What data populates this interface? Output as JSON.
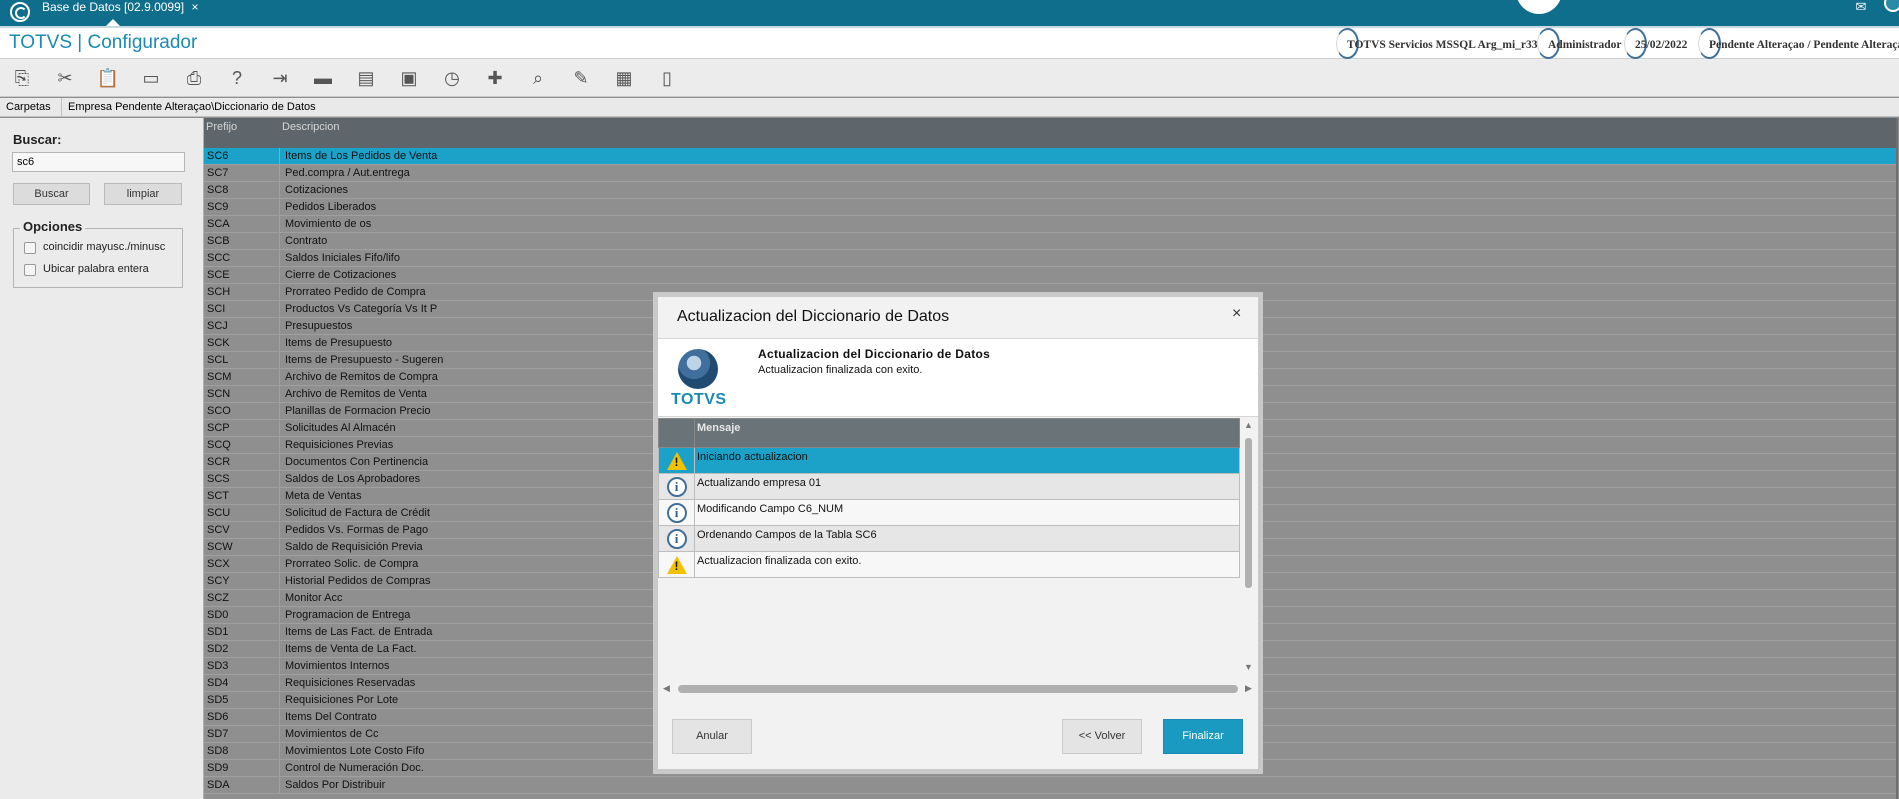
{
  "titlebar": {
    "tab_label": "Base de Datos [02.9.0099]",
    "tab_close": "×",
    "mail_icon": "✉"
  },
  "header": {
    "brand": "TOTVS | Configurador",
    "server": "TOTVS Servicios MSSQL Arg_mi_r33",
    "user": "Administrador",
    "date": "25/02/2022",
    "status": "Pendente Alteraçao / Pendente Alteraça"
  },
  "toolbar": {
    "icons": [
      "copy-icon",
      "cut-icon",
      "paste-icon",
      "eraser-icon",
      "print-icon",
      "help-icon",
      "exit-icon",
      "folder-icon",
      "table-icon",
      "save-icon",
      "disk-clock-icon",
      "add-icon",
      "search-icon",
      "edit-icon",
      "grid-icon",
      "document-icon"
    ],
    "glyphs": [
      "⎘",
      "✂",
      "📋",
      "▭",
      "⎙",
      "?",
      "⇥",
      "▬",
      "▤",
      "▣",
      "◷",
      "✚",
      "⌕",
      "✎",
      "▦",
      "▯"
    ]
  },
  "pathbar": {
    "folders_label": "Carpetas",
    "path": "Empresa Pendente Alteraçao\\Diccionario de Datos"
  },
  "leftpanel": {
    "search_label": "Buscar:",
    "search_value": "sc6",
    "buscar_button": "Buscar",
    "limpiar_button": "limpiar",
    "options_label": "Opciones",
    "option1": "coincidir mayusc./minusc",
    "option2": "Ubicar palabra entera"
  },
  "grid": {
    "col_prefix": "Prefijo",
    "col_desc": "Descripcion",
    "rows": [
      {
        "p": "SC6",
        "d": "Items de Los Pedidos de Venta"
      },
      {
        "p": "SC7",
        "d": "Ped.compra / Aut.entrega"
      },
      {
        "p": "SC8",
        "d": "Cotizaciones"
      },
      {
        "p": "SC9",
        "d": "Pedidos Liberados"
      },
      {
        "p": "SCA",
        "d": "Movimiento de os"
      },
      {
        "p": "SCB",
        "d": "Contrato"
      },
      {
        "p": "SCC",
        "d": "Saldos Iniciales Fifo/lifo"
      },
      {
        "p": "SCE",
        "d": "Cierre de Cotizaciones"
      },
      {
        "p": "SCH",
        "d": "Prorrateo Pedido de Compra"
      },
      {
        "p": "SCI",
        "d": "Productos Vs Categoría Vs It P"
      },
      {
        "p": "SCJ",
        "d": "Presupuestos"
      },
      {
        "p": "SCK",
        "d": "Items de Presupuesto"
      },
      {
        "p": "SCL",
        "d": "Items de Presupuesto - Sugeren"
      },
      {
        "p": "SCM",
        "d": "Archivo de Remitos de Compra"
      },
      {
        "p": "SCN",
        "d": "Archivo de Remitos de Venta"
      },
      {
        "p": "SCO",
        "d": "Planillas de Formacion Precio"
      },
      {
        "p": "SCP",
        "d": "Solicitudes Al Almacén"
      },
      {
        "p": "SCQ",
        "d": "Requisiciones Previas"
      },
      {
        "p": "SCR",
        "d": "Documentos Con Pertinencia"
      },
      {
        "p": "SCS",
        "d": "Saldos de Los Aprobadores"
      },
      {
        "p": "SCT",
        "d": "Meta de Ventas"
      },
      {
        "p": "SCU",
        "d": "Solicitud de Factura de Crédit"
      },
      {
        "p": "SCV",
        "d": "Pedidos Vs. Formas de Pago"
      },
      {
        "p": "SCW",
        "d": "Saldo de Requisición Previa"
      },
      {
        "p": "SCX",
        "d": "Prorrateo Solic. de Compra"
      },
      {
        "p": "SCY",
        "d": "Historial Pedidos de Compras"
      },
      {
        "p": "SCZ",
        "d": "Monitor Acc"
      },
      {
        "p": "SD0",
        "d": "Programacion de Entrega"
      },
      {
        "p": "SD1",
        "d": "Items de Las Fact. de Entrada"
      },
      {
        "p": "SD2",
        "d": "Items de Venta de La Fact."
      },
      {
        "p": "SD3",
        "d": "Movimientos Internos"
      },
      {
        "p": "SD4",
        "d": "Requisiciones Reservadas"
      },
      {
        "p": "SD5",
        "d": "Requisiciones Por Lote"
      },
      {
        "p": "SD6",
        "d": "Items Del Contrato"
      },
      {
        "p": "SD7",
        "d": "Movimientos de Cc"
      },
      {
        "p": "SD8",
        "d": "Movimientos Lote Costo Fifo"
      },
      {
        "p": "SD9",
        "d": "Control de Numeración Doc."
      },
      {
        "p": "SDA",
        "d": "Saldos Por Distribuir"
      }
    ]
  },
  "modal": {
    "title": "Actualizacion del Diccionario de Datos",
    "close": "×",
    "logo_text": "TOTVS",
    "heading": "Actualizacion del Diccionario de Datos",
    "subheading": "Actualizacion finalizada con exito.",
    "col_message": "Mensaje",
    "messages": [
      {
        "type": "warning",
        "text": "Iniciando actualizacion"
      },
      {
        "type": "info",
        "text": "Actualizando empresa 01"
      },
      {
        "type": "info",
        "text": "Modificando Campo C6_NUM"
      },
      {
        "type": "info",
        "text": "Ordenando Campos de la Tabla SC6"
      },
      {
        "type": "warning",
        "text": "Actualizacion finalizada con exito."
      }
    ],
    "btn_cancel": "Anular",
    "btn_back": "<< Volver",
    "btn_finish": "Finalizar"
  }
}
